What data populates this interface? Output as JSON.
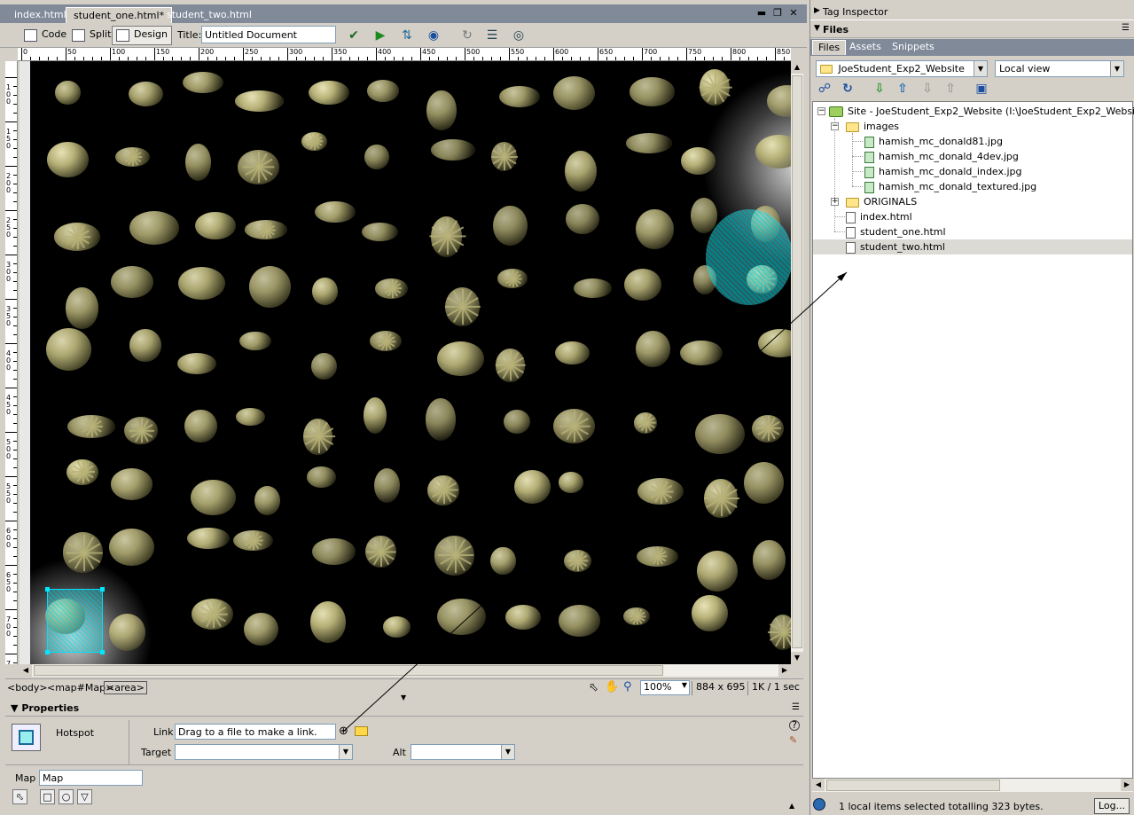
{
  "document_tabs": [
    {
      "label": "index.html",
      "active": false
    },
    {
      "label": "student_one.html*",
      "active": true
    },
    {
      "label": "student_two.html",
      "active": false
    }
  ],
  "toolbar": {
    "code_label": "Code",
    "split_label": "Split",
    "design_label": "Design",
    "title_label": "Title:",
    "title_value": "Untitled Document"
  },
  "ruler": {
    "h_labels": [
      "0",
      "50",
      "100",
      "150",
      "200",
      "250",
      "300",
      "350",
      "400",
      "450",
      "500",
      "550",
      "600",
      "650",
      "700",
      "750",
      "800",
      "850"
    ],
    "v_labels": [
      "100",
      "150",
      "200",
      "250",
      "300",
      "350",
      "400",
      "450",
      "500",
      "550",
      "600",
      "650",
      "700",
      "750"
    ]
  },
  "status_bar": {
    "tags": [
      "<body>",
      "<map#Map>",
      "<area>"
    ],
    "zoom": "100%",
    "dimensions": "884 x 695",
    "download": "1K / 1 sec"
  },
  "properties": {
    "header": "Properties",
    "element_type": "Hotspot",
    "link_label": "Link",
    "link_value": "Drag to a file to make a link.",
    "target_label": "Target",
    "target_value": "",
    "alt_label": "Alt",
    "alt_value": "",
    "map_label": "Map",
    "map_value": "Map"
  },
  "right_panel": {
    "tag_inspector_label": "Tag Inspector",
    "files_label": "Files",
    "tabs": [
      "Files",
      "Assets",
      "Snippets"
    ],
    "site_select": "JoeStudent_Exp2_Website",
    "view_select": "Local view",
    "tree": {
      "site": "Site - JoeStudent_Exp2_Website (I:\\JoeStudent_Exp2_Website)",
      "images_folder": "images",
      "images": [
        "hamish_mc_donald81.jpg",
        "hamish_mc_donald_4dev.jpg",
        "hamish_mc_donald_index.jpg",
        "hamish_mc_donald_textured.jpg"
      ],
      "originals_folder": "ORIGINALS",
      "pages": [
        "index.html",
        "student_one.html",
        "student_two.html"
      ]
    },
    "status_text": "1 local items selected totalling 323 bytes.",
    "log_button": "Log..."
  },
  "colors": {
    "hotspot": "#00e0ff",
    "canvas_bg": "#000000",
    "panel_bg": "#d4d0c8",
    "creature": "#b8b278"
  }
}
